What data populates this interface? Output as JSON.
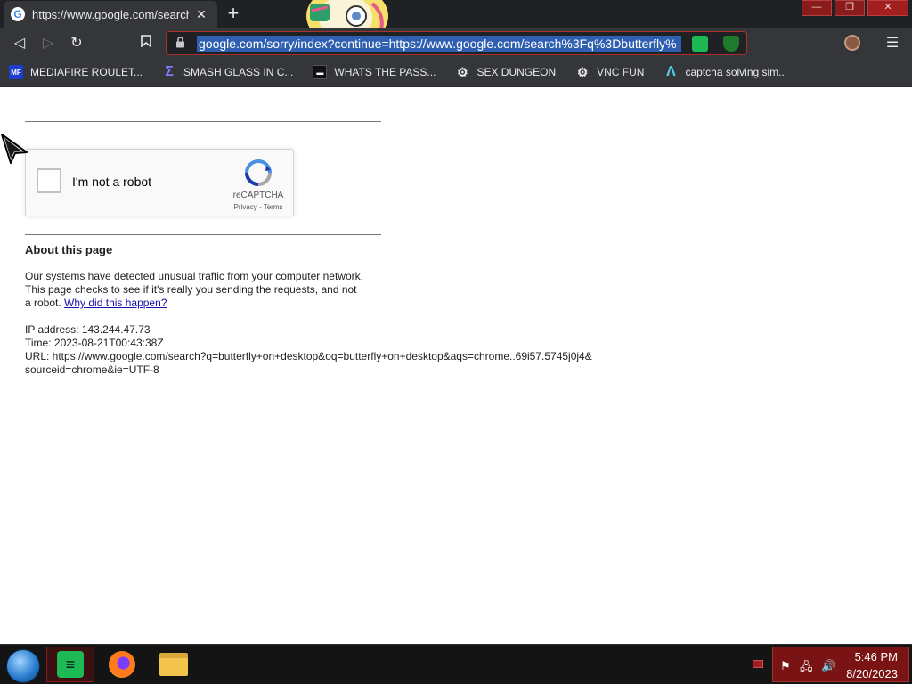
{
  "browser": {
    "tab": {
      "favicon": "G",
      "title": "https://www.google.com/search?q=butterfly+on+desktop",
      "close_glyph": "✕"
    },
    "new_tab_glyph": "+",
    "window_controls": {
      "minimize": "—",
      "maximize": "❐",
      "close": "✕"
    },
    "nav": {
      "back_glyph": "◁",
      "forward_glyph": "▷",
      "reload_glyph": "↻",
      "bookmark_glyph": "🔖"
    },
    "address_bar": {
      "url": "google.com/sorry/index?continue=https://www.google.com/search%3Fq%3Dbutterfly%",
      "lock_glyph": "🔒"
    },
    "menu_glyph": "☰",
    "bookmarks": [
      {
        "label": "MEDIAFIRE ROULET...",
        "icon": "mediafire-icon",
        "glyph": "MF"
      },
      {
        "label": "SMASH GLASS IN C...",
        "icon": "smash-glass-icon",
        "glyph": "Σ"
      },
      {
        "label": "WHATS THE PASS...",
        "icon": "whats-the-pass-icon",
        "glyph": "▬"
      },
      {
        "label": "SEX DUNGEON",
        "icon": "gear-skull-icon",
        "glyph": "⚙"
      },
      {
        "label": "VNC FUN",
        "icon": "gear-skull-icon",
        "glyph": "⚙"
      },
      {
        "label": "captcha solving sim...",
        "icon": "captcha-sim-icon",
        "glyph": "Λ"
      }
    ]
  },
  "page": {
    "recaptcha": {
      "checkbox_label": "I'm not a robot",
      "brand": "reCAPTCHA",
      "links": "Privacy - Terms"
    },
    "about_title": "About this page",
    "explanation": "Our systems have detected unusual traffic from your computer network. This page checks to see if it's really you sending the requests, and not a robot.",
    "why_link": "Why did this happen?",
    "ip_line": "IP address: 143.244.47.73",
    "time_line": "Time: 2023-08-21T00:43:38Z",
    "url_line": "URL: https://www.google.com/search?q=butterfly+on+desktop&oq=butterfly+on+desktop&aqs=chrome..69i57.5745j0j4&sourceid=chrome&ie=UTF-8"
  },
  "taskbar": {
    "apps": [
      {
        "name": "spotify",
        "icon": "spotify-icon",
        "active": true
      },
      {
        "name": "firefox",
        "icon": "firefox-icon",
        "active": false
      },
      {
        "name": "file-explorer",
        "icon": "folder-icon",
        "active": false
      }
    ],
    "tray_icons": [
      "flag-icon",
      "network-icon",
      "volume-icon"
    ],
    "tray_glyphs": {
      "flag": "⚑",
      "network": "🖧",
      "volume": "🔊"
    },
    "clock": {
      "time": "5:46 PM",
      "date": "8/20/2023"
    }
  },
  "colors": {
    "accent_red": "#8a1c1c",
    "link": "#1a0dab",
    "url_selection": "#2f5fb0",
    "recaptcha_blue": "#4a90e2"
  }
}
